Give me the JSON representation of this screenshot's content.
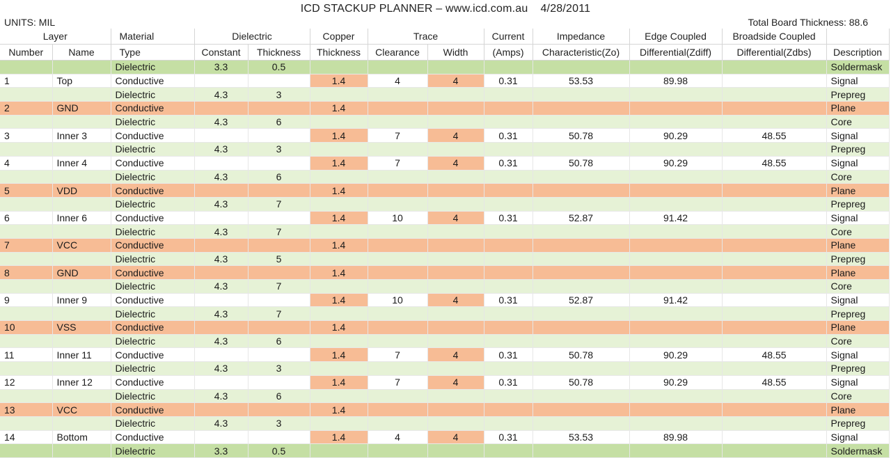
{
  "header": {
    "title": "ICD STACKUP PLANNER – www.icd.com.au",
    "date": "4/28/2011",
    "units": "UNITS: MIL",
    "total_thickness": "Total Board Thickness: 88.6"
  },
  "columns": {
    "group": [
      "Layer",
      "Material",
      "Dielectric",
      "Copper",
      "Trace",
      "Current",
      "Impedance",
      "Edge Coupled",
      "Broadside Coupled",
      ""
    ],
    "sub": [
      "Number",
      "Name",
      "Type",
      "Constant",
      "Thickness",
      "Thickness",
      "Clearance",
      "Width",
      "(Amps)",
      "Characteristic(Zo)",
      "Differential(Zdiff)",
      "Differential(Zdbs)",
      "Description"
    ]
  },
  "rows": [
    [
      "",
      "",
      "Dielectric",
      "3.3",
      "0.5",
      "",
      "",
      "",
      "",
      "",
      "",
      "",
      "Soldermask"
    ],
    [
      "1",
      "Top",
      "Conductive",
      "",
      "",
      "1.4",
      "4",
      "4",
      "0.31",
      "53.53",
      "89.98",
      "",
      "Signal"
    ],
    [
      "",
      "",
      "Dielectric",
      "4.3",
      "3",
      "",
      "",
      "",
      "",
      "",
      "",
      "",
      "Prepreg"
    ],
    [
      "2",
      "GND",
      "Conductive",
      "",
      "",
      "1.4",
      "",
      "",
      "",
      "",
      "",
      "",
      "Plane"
    ],
    [
      "",
      "",
      "Dielectric",
      "4.3",
      "6",
      "",
      "",
      "",
      "",
      "",
      "",
      "",
      "Core"
    ],
    [
      "3",
      "Inner 3",
      "Conductive",
      "",
      "",
      "1.4",
      "7",
      "4",
      "0.31",
      "50.78",
      "90.29",
      "48.55",
      "Signal"
    ],
    [
      "",
      "",
      "Dielectric",
      "4.3",
      "3",
      "",
      "",
      "",
      "",
      "",
      "",
      "",
      "Prepreg"
    ],
    [
      "4",
      "Inner 4",
      "Conductive",
      "",
      "",
      "1.4",
      "7",
      "4",
      "0.31",
      "50.78",
      "90.29",
      "48.55",
      "Signal"
    ],
    [
      "",
      "",
      "Dielectric",
      "4.3",
      "6",
      "",
      "",
      "",
      "",
      "",
      "",
      "",
      "Core"
    ],
    [
      "5",
      "VDD",
      "Conductive",
      "",
      "",
      "1.4",
      "",
      "",
      "",
      "",
      "",
      "",
      "Plane"
    ],
    [
      "",
      "",
      "Dielectric",
      "4.3",
      "7",
      "",
      "",
      "",
      "",
      "",
      "",
      "",
      "Prepreg"
    ],
    [
      "6",
      "Inner 6",
      "Conductive",
      "",
      "",
      "1.4",
      "10",
      "4",
      "0.31",
      "52.87",
      "91.42",
      "",
      "Signal"
    ],
    [
      "",
      "",
      "Dielectric",
      "4.3",
      "7",
      "",
      "",
      "",
      "",
      "",
      "",
      "",
      "Core"
    ],
    [
      "7",
      "VCC",
      "Conductive",
      "",
      "",
      "1.4",
      "",
      "",
      "",
      "",
      "",
      "",
      "Plane"
    ],
    [
      "",
      "",
      "Dielectric",
      "4.3",
      "5",
      "",
      "",
      "",
      "",
      "",
      "",
      "",
      "Prepreg"
    ],
    [
      "8",
      "GND",
      "Conductive",
      "",
      "",
      "1.4",
      "",
      "",
      "",
      "",
      "",
      "",
      "Plane"
    ],
    [
      "",
      "",
      "Dielectric",
      "4.3",
      "7",
      "",
      "",
      "",
      "",
      "",
      "",
      "",
      "Core"
    ],
    [
      "9",
      "Inner 9",
      "Conductive",
      "",
      "",
      "1.4",
      "10",
      "4",
      "0.31",
      "52.87",
      "91.42",
      "",
      "Signal"
    ],
    [
      "",
      "",
      "Dielectric",
      "4.3",
      "7",
      "",
      "",
      "",
      "",
      "",
      "",
      "",
      "Prepreg"
    ],
    [
      "10",
      "VSS",
      "Conductive",
      "",
      "",
      "1.4",
      "",
      "",
      "",
      "",
      "",
      "",
      "Plane"
    ],
    [
      "",
      "",
      "Dielectric",
      "4.3",
      "6",
      "",
      "",
      "",
      "",
      "",
      "",
      "",
      "Core"
    ],
    [
      "11",
      "Inner 11",
      "Conductive",
      "",
      "",
      "1.4",
      "7",
      "4",
      "0.31",
      "50.78",
      "90.29",
      "48.55",
      "Signal"
    ],
    [
      "",
      "",
      "Dielectric",
      "4.3",
      "3",
      "",
      "",
      "",
      "",
      "",
      "",
      "",
      "Prepreg"
    ],
    [
      "12",
      "Inner 12",
      "Conductive",
      "",
      "",
      "1.4",
      "7",
      "4",
      "0.31",
      "50.78",
      "90.29",
      "48.55",
      "Signal"
    ],
    [
      "",
      "",
      "Dielectric",
      "4.3",
      "6",
      "",
      "",
      "",
      "",
      "",
      "",
      "",
      "Core"
    ],
    [
      "13",
      "VCC",
      "Conductive",
      "",
      "",
      "1.4",
      "",
      "",
      "",
      "",
      "",
      "",
      "Plane"
    ],
    [
      "",
      "",
      "Dielectric",
      "4.3",
      "3",
      "",
      "",
      "",
      "",
      "",
      "",
      "",
      "Prepreg"
    ],
    [
      "14",
      "Bottom",
      "Conductive",
      "",
      "",
      "1.4",
      "4",
      "4",
      "0.31",
      "53.53",
      "89.98",
      "",
      "Signal"
    ],
    [
      "",
      "",
      "Dielectric",
      "3.3",
      "0.5",
      "",
      "",
      "",
      "",
      "",
      "",
      "",
      "Soldermask"
    ]
  ],
  "colors": {
    "dielectric_row": "#e6f2d6",
    "soldermask_row": "#c5dfa4",
    "plane_row": "#f7bc95",
    "highlight_cell": "#f7bc95",
    "signal_row": "#ffffff"
  }
}
